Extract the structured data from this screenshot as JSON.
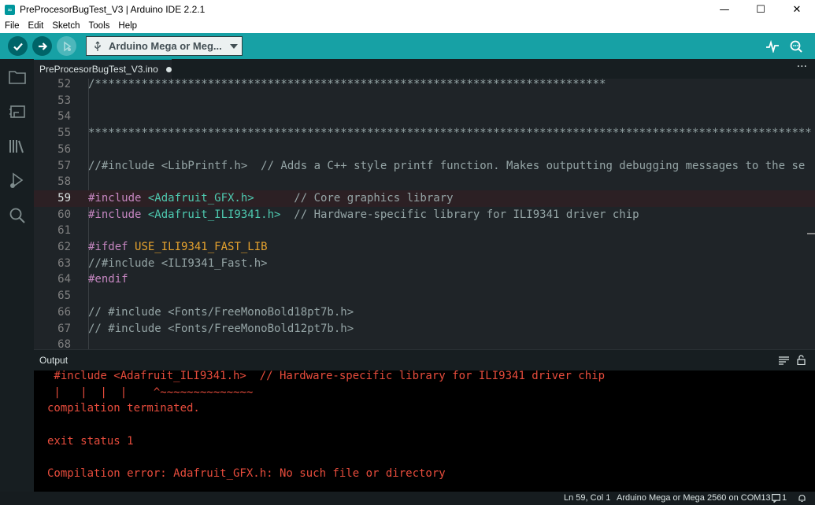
{
  "window": {
    "title": "PreProcesorBugTest_V3 | Arduino IDE 2.2.1",
    "minimize": "—",
    "maximize": "☐",
    "close": "✕"
  },
  "menu": [
    "File",
    "Edit",
    "Sketch",
    "Tools",
    "Help"
  ],
  "toolbar": {
    "board": "Arduino Mega or Meg...",
    "accent": "#17a1a5"
  },
  "tab": {
    "label": "PreProcesorBugTest_V3.ino",
    "more": "···"
  },
  "editor": {
    "lines": [
      {
        "n": "52",
        "text": "/*****************************************************************************"
      },
      {
        "n": "53",
        "text": ""
      },
      {
        "n": "54",
        "text": ""
      },
      {
        "n": "55",
        "text": "*************************************************************************************************************"
      },
      {
        "n": "56",
        "text": ""
      },
      {
        "n": "57",
        "text": "//#include <LibPrintf.h>  // Adds a C++ style printf function. Makes outputting debugging messages to the se"
      },
      {
        "n": "58",
        "text": ""
      },
      {
        "n": "59",
        "kw": "#include ",
        "inc": "<Adafruit_GFX.h>",
        "rest": "      // Core graphics library"
      },
      {
        "n": "60",
        "kw": "#include ",
        "inc": "<Adafruit_ILI9341.h>",
        "rest": "  // Hardware-specific library for ILI9341 driver chip"
      },
      {
        "n": "61",
        "text": ""
      },
      {
        "n": "62",
        "kw": "#ifdef ",
        "def": "USE_ILI9341_FAST_LIB"
      },
      {
        "n": "63",
        "text": "//#include <ILI9341_Fast.h>"
      },
      {
        "n": "64",
        "kw": "#endif"
      },
      {
        "n": "65",
        "text": ""
      },
      {
        "n": "66",
        "text": "// #include <Fonts/FreeMonoBold18pt7b.h>"
      },
      {
        "n": "67",
        "text": "// #include <Fonts/FreeMonoBold12pt7b.h>"
      },
      {
        "n": "68",
        "text": ""
      }
    ]
  },
  "output": {
    "title": "Output",
    "lines": [
      " #include <Adafruit_ILI9341.h>  // Hardware-specific library for ILI9341 driver chip",
      " |   |  |  |    ^~~~~~~~~~~~~~~",
      "compilation terminated.",
      "",
      "exit status 1",
      "",
      "Compilation error: Adafruit_GFX.h: No such file or directory"
    ]
  },
  "status": {
    "position": "Ln 59, Col 1",
    "board": "Arduino Mega or Mega 2560 on COM13",
    "notifications": "1"
  }
}
